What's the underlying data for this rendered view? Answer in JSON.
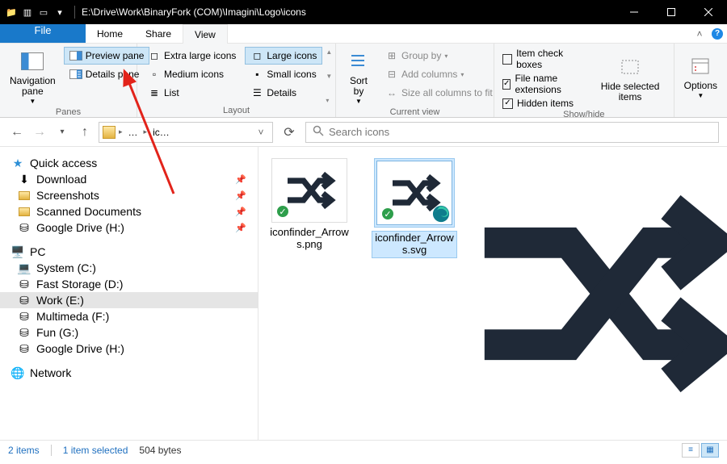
{
  "title": "E:\\Drive\\Work\\BinaryFork (COM)\\Imagini\\Logo\\icons",
  "menu": {
    "file": "File",
    "home": "Home",
    "share": "Share",
    "view": "View"
  },
  "ribbon": {
    "panes": {
      "label": "Panes",
      "navigation": "Navigation pane",
      "preview": "Preview pane",
      "details": "Details pane"
    },
    "layout": {
      "label": "Layout",
      "xl": "Extra large icons",
      "lg": "Large icons",
      "md": "Medium icons",
      "sm": "Small icons",
      "list": "List",
      "det": "Details"
    },
    "current": {
      "label": "Current view",
      "sort": "Sort by",
      "group": "Group by",
      "addcols": "Add columns",
      "sizecols": "Size all columns to fit"
    },
    "showhide": {
      "label": "Show/hide",
      "checkboxes": "Item check boxes",
      "ext": "File name extensions",
      "hidden": "Hidden items",
      "hidesel": "Hide selected items"
    },
    "options": "Options"
  },
  "address": {
    "crumb1": "…",
    "crumb2": "ic…"
  },
  "search_placeholder": "Search icons",
  "tree": {
    "quick": "Quick access",
    "items": [
      {
        "label": "Download",
        "icon": "down-green"
      },
      {
        "label": "Screenshots",
        "icon": "folder"
      },
      {
        "label": "Scanned Documents",
        "icon": "folder"
      },
      {
        "label": "Google Drive (H:)",
        "icon": "drive"
      }
    ],
    "pc": "PC",
    "drives": [
      {
        "label": "System (C:)",
        "icon": "sys"
      },
      {
        "label": "Fast Storage (D:)",
        "icon": "drive"
      },
      {
        "label": "Work (E:)",
        "icon": "drive",
        "selected": true
      },
      {
        "label": "Multimeda (F:)",
        "icon": "drive"
      },
      {
        "label": "Fun (G:)",
        "icon": "drive"
      },
      {
        "label": "Google Drive (H:)",
        "icon": "drive"
      }
    ],
    "network": "Network"
  },
  "files": [
    {
      "name": "iconfinder_Arrows.png",
      "selected": false,
      "badge": true
    },
    {
      "name": "iconfinder_Arrows.svg",
      "selected": true,
      "badge": true,
      "edge": true
    }
  ],
  "status": {
    "count": "2 items",
    "sel": "1 item selected",
    "size": "504 bytes"
  }
}
